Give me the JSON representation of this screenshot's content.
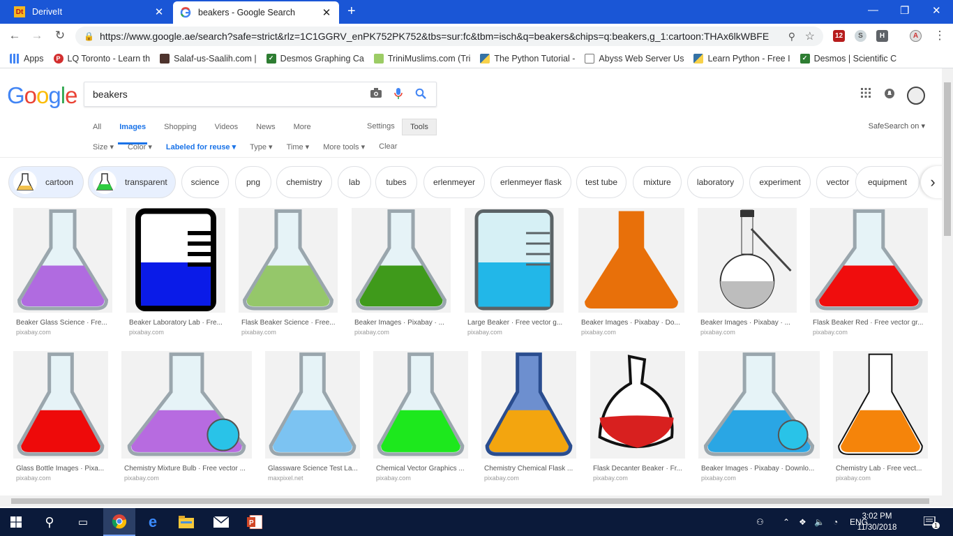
{
  "browser": {
    "tabs": [
      {
        "label": "DeriveIt",
        "icon": "deriveit-icon"
      },
      {
        "label": "beakers - Google Search",
        "icon": "google-g-icon"
      }
    ],
    "url": "https://www.google.ae/search?safe=strict&rlz=1C1GGRV_enPK752PK752&tbs=sur:fc&tbm=isch&q=beakers&chips=q:beakers,g_1:cartoon:THAx6lkWBFE...",
    "extension_badge": "12",
    "extension_letter": "H",
    "bookmarks": [
      "Apps",
      "LQ Toronto - Learn th",
      "Salaf-us-Saalih.com |",
      "Desmos Graphing Ca",
      "TriniMuslims.com (Tri",
      "The Python Tutorial -",
      "Abyss Web Server Us",
      "Learn Python - Free I",
      "Desmos | Scientific C"
    ]
  },
  "google": {
    "logo": [
      "G",
      "o",
      "o",
      "g",
      "l",
      "e"
    ],
    "logo_colors": [
      "#4285f4",
      "#ea4335",
      "#fbbc05",
      "#4285f4",
      "#34a853",
      "#ea4335"
    ],
    "query": "beakers",
    "nav_tabs": [
      "All",
      "Images",
      "Shopping",
      "Videos",
      "News",
      "More"
    ],
    "active_tab": "Images",
    "settings": "Settings",
    "tools": "Tools",
    "filters": [
      "Size ▾",
      "Color ▾",
      "Labeled for reuse ▾",
      "Type ▾",
      "Time ▾",
      "More tools ▾",
      "Clear"
    ],
    "safesearch": "SafeSearch on ▾",
    "chips": [
      "cartoon",
      "transparent",
      "science",
      "png",
      "chemistry",
      "lab",
      "tubes",
      "erlenmeyer",
      "erlenmeyer flask",
      "test tube",
      "mixture",
      "laboratory",
      "experiment",
      "vector",
      "equipment"
    ]
  },
  "results": [
    {
      "caption": "Beaker Glass Science · Fre...",
      "source": "pixabay.com",
      "liquid": "#b06be0"
    },
    {
      "caption": "Beaker Laboratory Lab · Fre...",
      "source": "pixabay.com",
      "liquid": "#0a1be8"
    },
    {
      "caption": "Flask Beaker Science · Free...",
      "source": "pixabay.com",
      "liquid": "#95c76a"
    },
    {
      "caption": "Beaker Images · Pixabay · ...",
      "source": "pixabay.com",
      "liquid": "#3f9a1b"
    },
    {
      "caption": "Large Beaker · Free vector g...",
      "source": "pixabay.com",
      "liquid": "#22b7e8"
    },
    {
      "caption": "Beaker Images · Pixabay · Do...",
      "source": "pixabay.com",
      "liquid": "#e8700a"
    },
    {
      "caption": "Beaker Images · Pixabay · ...",
      "source": "pixabay.com",
      "liquid": "#bdbdbd"
    },
    {
      "caption": "Flask Beaker Red · Free vector gr...",
      "source": "pixabay.com",
      "liquid": "#f00d0d"
    },
    {
      "caption": "Glass Bottle Images · Pixa...",
      "source": "pixabay.com",
      "liquid": "#ee0a0a"
    },
    {
      "caption": "Chemistry Mixture Bulb · Free vector ...",
      "source": "pixabay.com",
      "liquid": "#b76be0"
    },
    {
      "caption": "Glassware Science Test La...",
      "source": "maxpixel.net",
      "liquid": "#7cc3f2"
    },
    {
      "caption": "Chemical Vector Graphics ...",
      "source": "pixabay.com",
      "liquid": "#1de81d"
    },
    {
      "caption": "Chemistry Chemical Flask ...",
      "source": "pixabay.com",
      "liquid": "#f3a50f"
    },
    {
      "caption": "Flask Decanter Beaker · Fr...",
      "source": "pixabay.com",
      "liquid": "#d8201f"
    },
    {
      "caption": "Beaker Images · Pixabay · Downlo...",
      "source": "pixabay.com",
      "liquid": "#2aa6e4"
    },
    {
      "caption": "Chemistry Lab · Free vect...",
      "source": "pixabay.com",
      "liquid": "#f5840a"
    }
  ],
  "taskbar": {
    "time": "3:02 PM",
    "date": "11/30/2018",
    "lang": "ENG",
    "notifications": "1"
  }
}
